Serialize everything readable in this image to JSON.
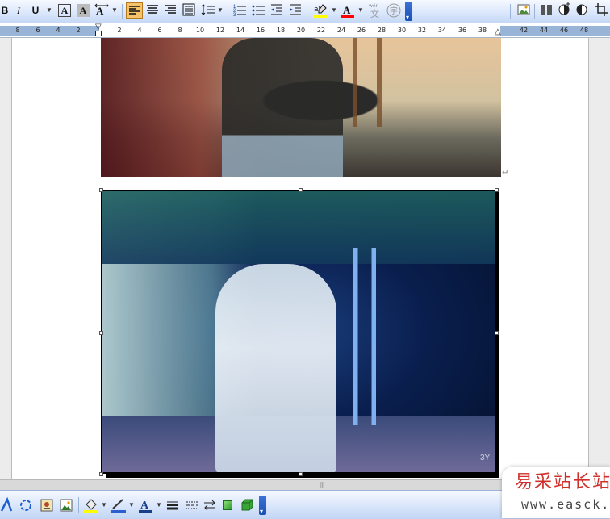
{
  "toolbar_top": {
    "bold_label": "B",
    "italic_label": "I",
    "underline_label": "U",
    "char_border_label": "A",
    "char_shading_label": "A",
    "font_color_label": "A",
    "highlight_label": "ab",
    "phonetic_label": "wén",
    "phonetic_char": "文",
    "enclose_char": "字",
    "align_left_active": true
  },
  "ruler": {
    "labels_left": [
      "8",
      "6",
      "4",
      "2"
    ],
    "labels_right": [
      "2",
      "4",
      "6",
      "8",
      "10",
      "12",
      "14",
      "16",
      "18",
      "20",
      "22",
      "24",
      "26",
      "28",
      "30",
      "32",
      "34",
      "36",
      "38",
      "42",
      "44",
      "46",
      "48"
    ]
  },
  "document": {
    "paragraph_mark": "↵",
    "image2_caption_fragment": "3Y"
  },
  "toolbar_bottom": {
    "font_color_label": "A"
  },
  "watermark": {
    "chinese": "易采站长站",
    "url": "www.easck.com"
  },
  "colors": {
    "toolbar_bg": "#d9e6fb",
    "active_button": "#f6c26a",
    "ruler_margin": "#98b4d6",
    "highlight_yellow": "#ffff00",
    "font_color_red": "#ff0000",
    "logo_red": "#d0302b"
  }
}
